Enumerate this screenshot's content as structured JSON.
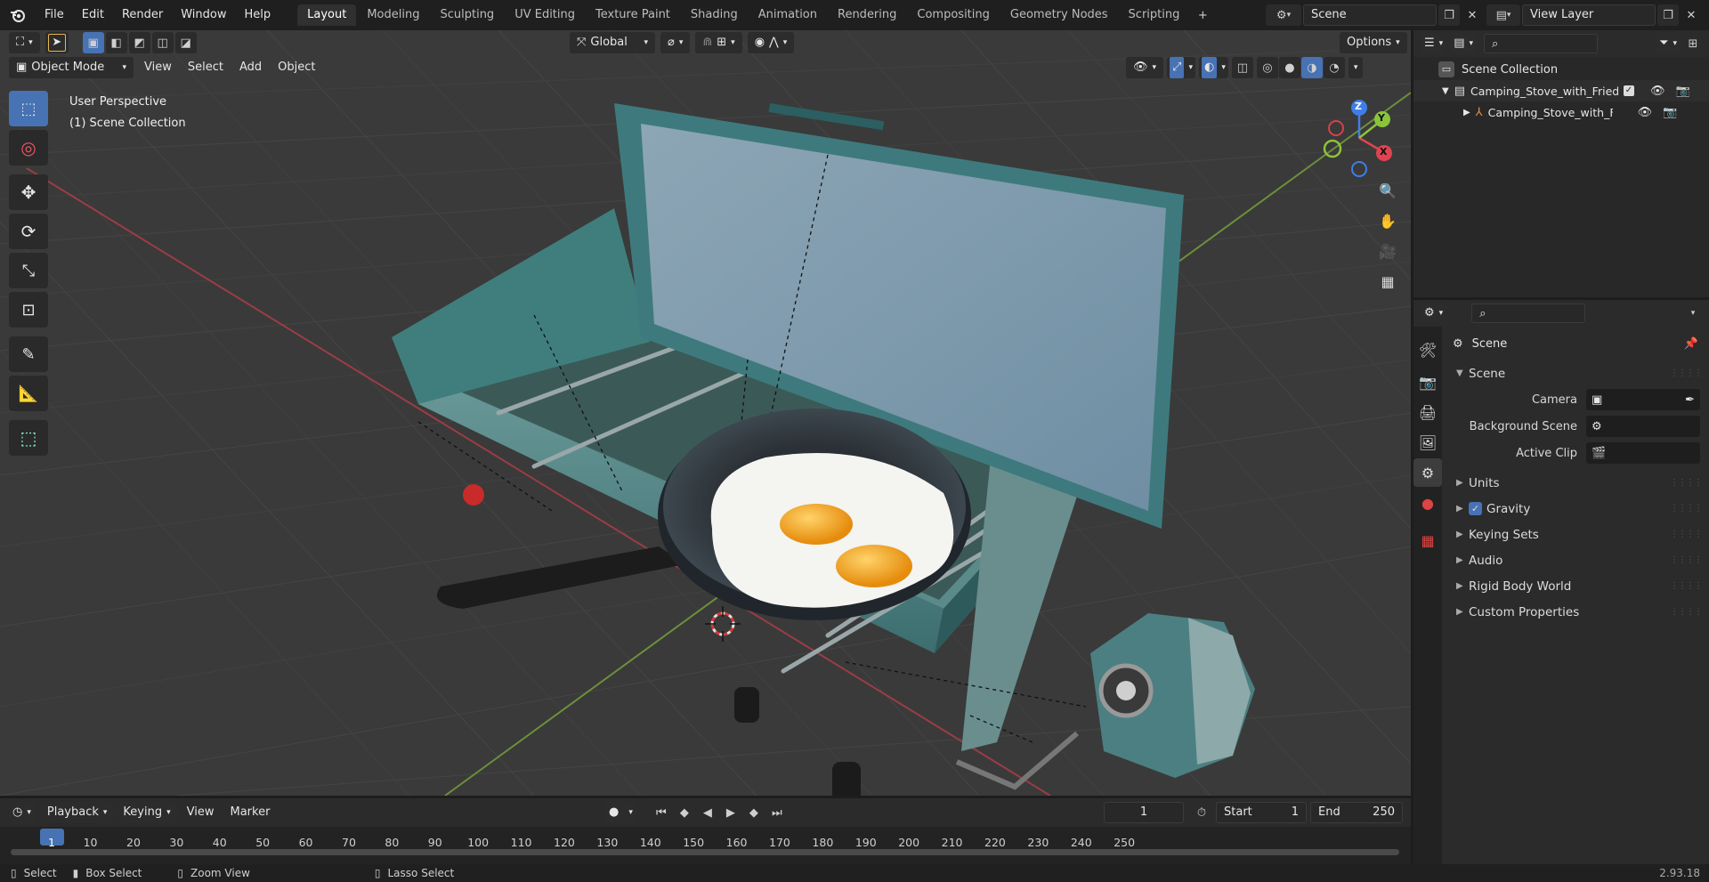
{
  "topbar": {
    "menus": [
      "File",
      "Edit",
      "Render",
      "Window",
      "Help"
    ],
    "workspaces": [
      "Layout",
      "Modeling",
      "Sculpting",
      "UV Editing",
      "Texture Paint",
      "Shading",
      "Animation",
      "Rendering",
      "Compositing",
      "Geometry Nodes",
      "Scripting"
    ],
    "active_workspace": "Layout",
    "add_tab": "+",
    "scene_name": "Scene",
    "view_layer": "View Layer"
  },
  "viewport": {
    "mode": "Object Mode",
    "menus": [
      "View",
      "Select",
      "Add",
      "Object"
    ],
    "orientation": "Global",
    "options": "Options",
    "perspective_label": "User Perspective",
    "collection_label": "(1) Scene Collection",
    "gizmo": {
      "x": "X",
      "y": "Y",
      "z": "Z"
    }
  },
  "outliner": {
    "root": "Scene Collection",
    "items": [
      {
        "label": "Camping_Stove_with_Fried_E",
        "level": 1
      },
      {
        "label": "Camping_Stove_with_Fri",
        "level": 2
      }
    ]
  },
  "properties": {
    "context": "Scene",
    "section": "Scene",
    "rows": [
      {
        "label": "Camera",
        "value": ""
      },
      {
        "label": "Background Scene",
        "value": ""
      },
      {
        "label": "Active Clip",
        "value": ""
      }
    ],
    "panels": [
      "Units",
      "Gravity",
      "Keying Sets",
      "Audio",
      "Rigid Body World",
      "Custom Properties"
    ],
    "gravity_checked": true
  },
  "timeline": {
    "menus": [
      "Playback",
      "Keying",
      "View",
      "Marker"
    ],
    "current_frame": "1",
    "start_label": "Start",
    "start": "1",
    "end_label": "End",
    "end": "250",
    "ruler": [
      "1",
      "10",
      "20",
      "30",
      "40",
      "50",
      "60",
      "70",
      "80",
      "90",
      "100",
      "110",
      "120",
      "130",
      "140",
      "150",
      "160",
      "170",
      "180",
      "190",
      "200",
      "210",
      "220",
      "230",
      "240",
      "250"
    ]
  },
  "status": {
    "select": "Select",
    "box_select": "Box Select",
    "zoom_view": "Zoom View",
    "lasso_select": "Lasso Select",
    "version": "2.93.18"
  },
  "colors": {
    "accent": "#4772b3",
    "axis_x": "#e2424f",
    "axis_y": "#8bc43b",
    "axis_z": "#3f7ee8",
    "stove_teal": "#3e7a7d",
    "egg_yolk": "#f2a31a"
  }
}
